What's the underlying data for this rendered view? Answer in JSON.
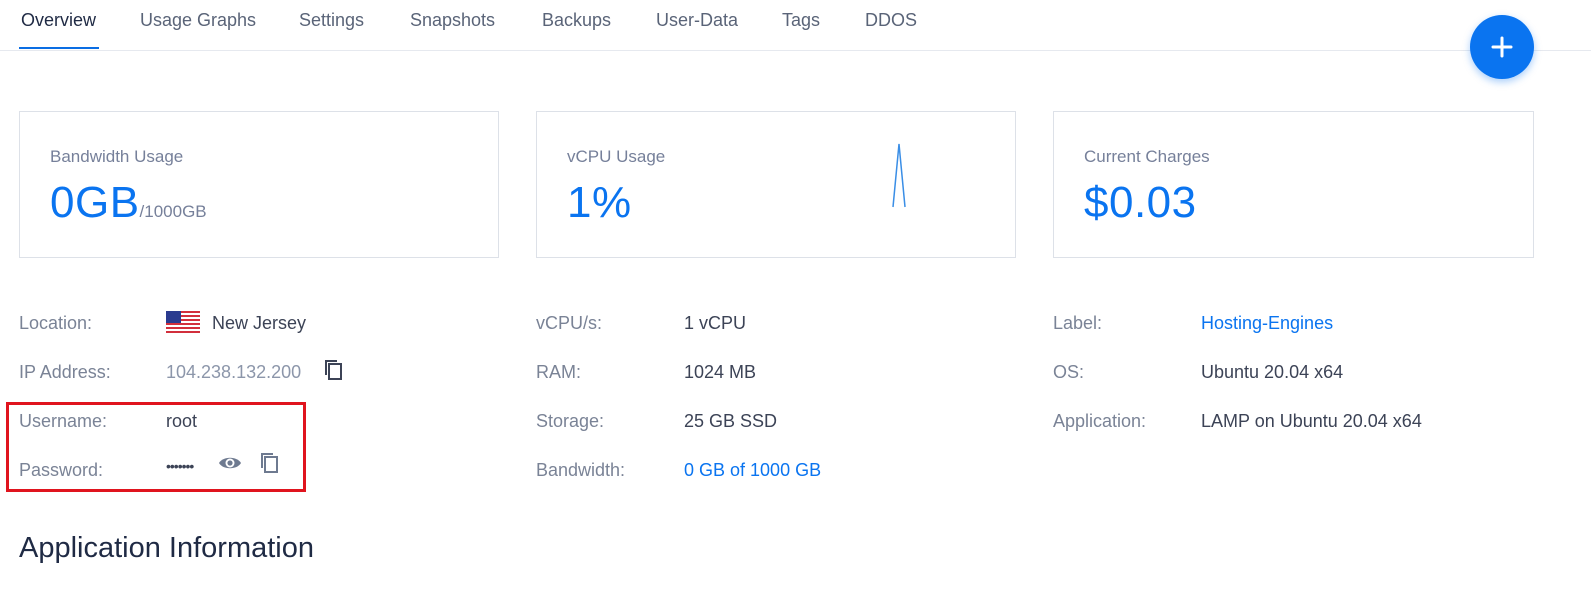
{
  "tabs": [
    {
      "label": "Overview",
      "active": true
    },
    {
      "label": "Usage Graphs"
    },
    {
      "label": "Settings"
    },
    {
      "label": "Snapshots"
    },
    {
      "label": "Backups"
    },
    {
      "label": "User-Data"
    },
    {
      "label": "Tags"
    },
    {
      "label": "DDOS"
    }
  ],
  "fab": {
    "icon": "plus-icon"
  },
  "cards": {
    "bandwidth": {
      "title": "Bandwidth Usage",
      "value": "0GB",
      "sub": "/1000GB"
    },
    "vcpu": {
      "title": "vCPU Usage",
      "value": "1%"
    },
    "charges": {
      "title": "Current Charges",
      "value": "$0.03"
    }
  },
  "info": {
    "location": {
      "label": "Location:",
      "value": "New Jersey",
      "flag": "us-flag-icon"
    },
    "ip": {
      "label": "IP Address:",
      "value": "104.238.132.200"
    },
    "username": {
      "label": "Username:",
      "value": "root"
    },
    "password": {
      "label": "Password:",
      "value": "•••••••"
    },
    "vcpus": {
      "label": "vCPU/s:",
      "value": "1 vCPU"
    },
    "ram": {
      "label": "RAM:",
      "value": "1024 MB"
    },
    "storage": {
      "label": "Storage:",
      "value": "25 GB SSD"
    },
    "bandwidth": {
      "label": "Bandwidth:",
      "value": "0 GB of 1000 GB"
    },
    "label": {
      "label": "Label:",
      "value": "Hosting-Engines"
    },
    "os": {
      "label": "OS:",
      "value": "Ubuntu 20.04 x64"
    },
    "application": {
      "label": "Application:",
      "value": "LAMP on Ubuntu 20.04 x64"
    }
  },
  "section": {
    "title": "Application Information"
  },
  "colors": {
    "accent": "#0a74f0",
    "highlight": "#e0141e"
  }
}
